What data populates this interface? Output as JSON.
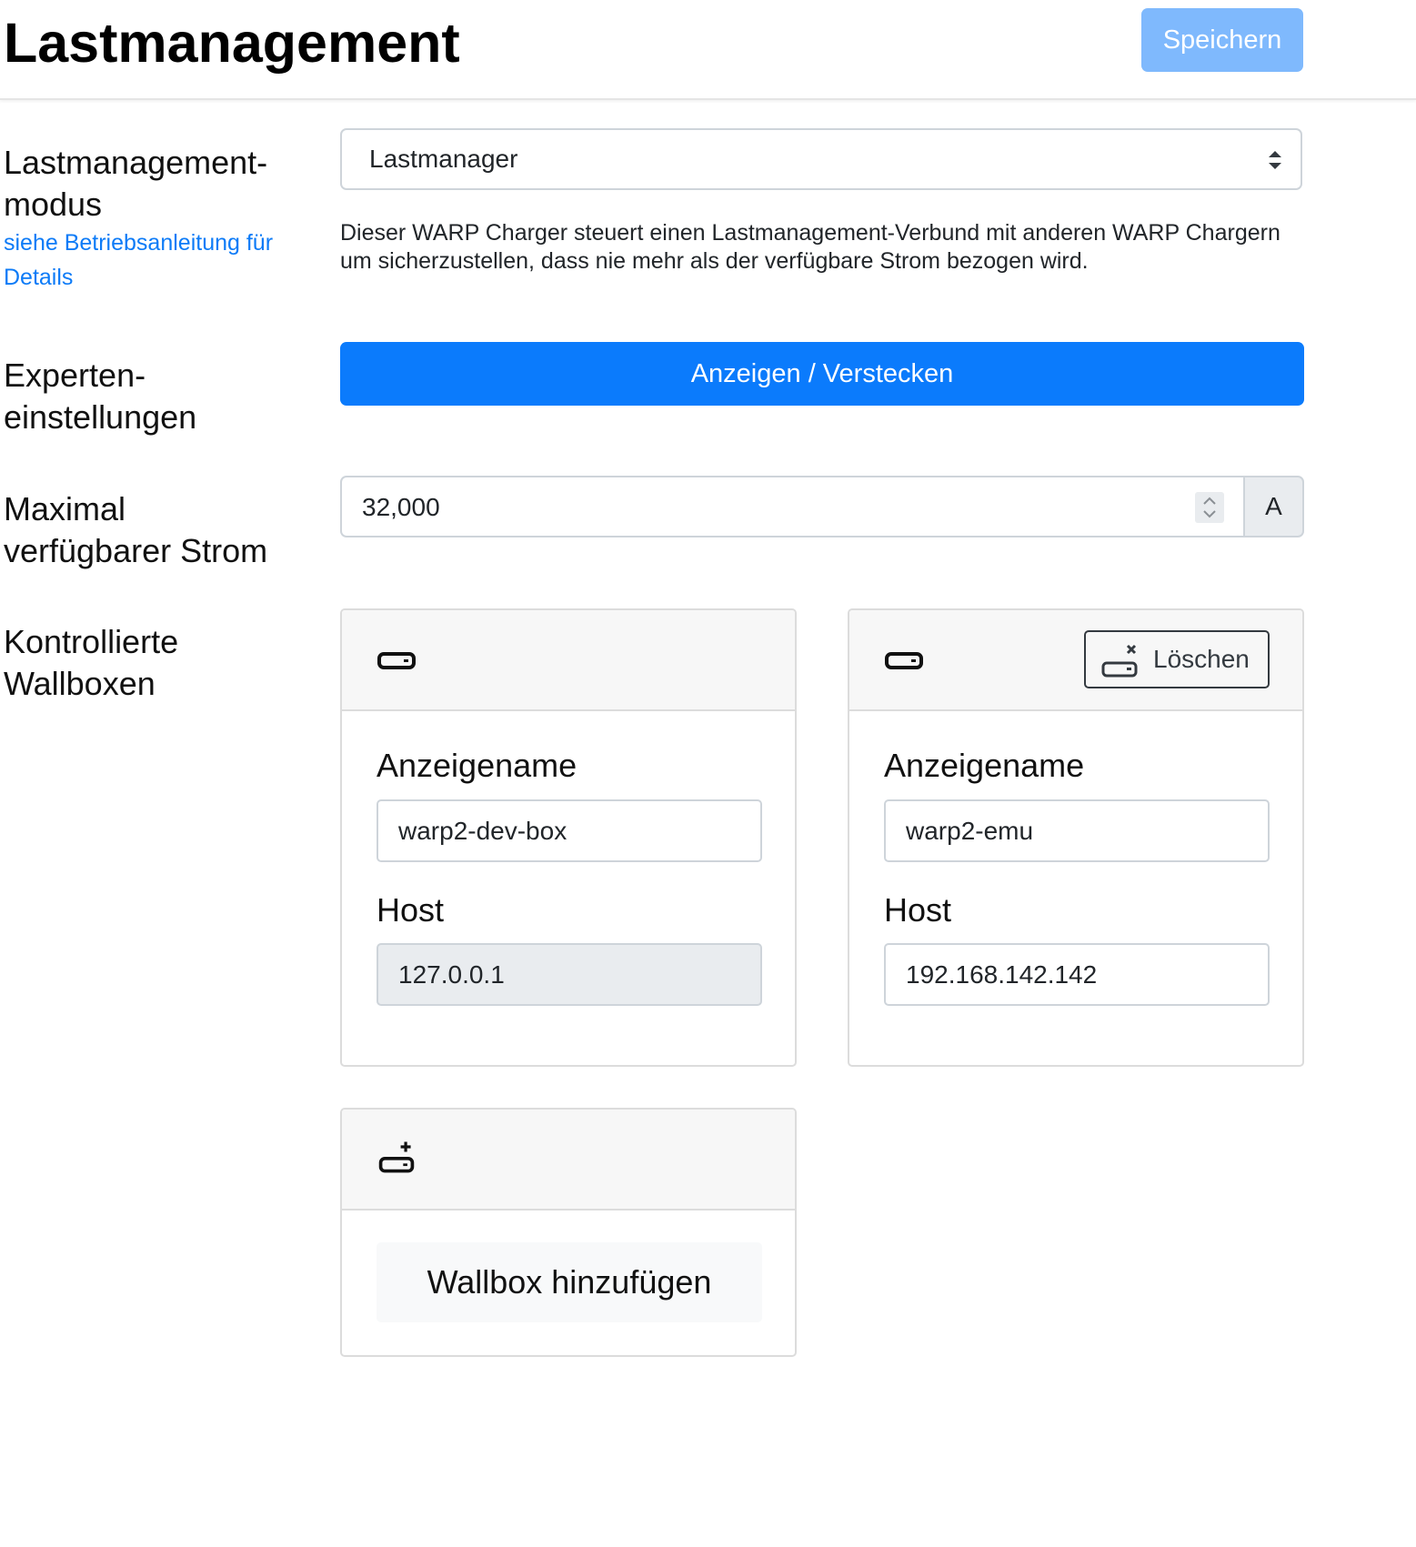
{
  "header": {
    "title": "Lastmanagement",
    "save_label": "Speichern"
  },
  "mode": {
    "label": "Lastmanagement-modus",
    "help_link": "siehe Betriebsanleitung für Details",
    "selected": "Lastmanager",
    "description": "Dieser WARP Charger steuert einen Lastmanagement-Verbund mit anderen WARP Chargern um sicherzustellen, dass nie mehr als der verfügbare Strom bezogen wird."
  },
  "expert": {
    "label": "Experten-einstellungen",
    "button_label": "Anzeigen / Verstecken"
  },
  "max_current": {
    "label": "Maximal verfügbarer Strom",
    "value": "32,000",
    "unit": "A"
  },
  "wallboxes": {
    "label": "Kontrollierte Wallboxen",
    "items": [
      {
        "name_label": "Anzeigename",
        "name": "warp2-dev-box",
        "host_label": "Host",
        "host": "127.0.0.1"
      },
      {
        "name_label": "Anzeigename",
        "name": "warp2-emu",
        "host_label": "Host",
        "host": "192.168.142.142",
        "delete_label": "Löschen"
      }
    ],
    "add_label": "Wallbox hinzufügen"
  },
  "colors": {
    "primary": "#0b7bfc",
    "primary_light": "#7fb9fd",
    "link": "#0d7bf7"
  },
  "icons": {
    "wallbox": "charger-icon",
    "delete": "charger-remove-icon",
    "add": "charger-add-icon"
  }
}
